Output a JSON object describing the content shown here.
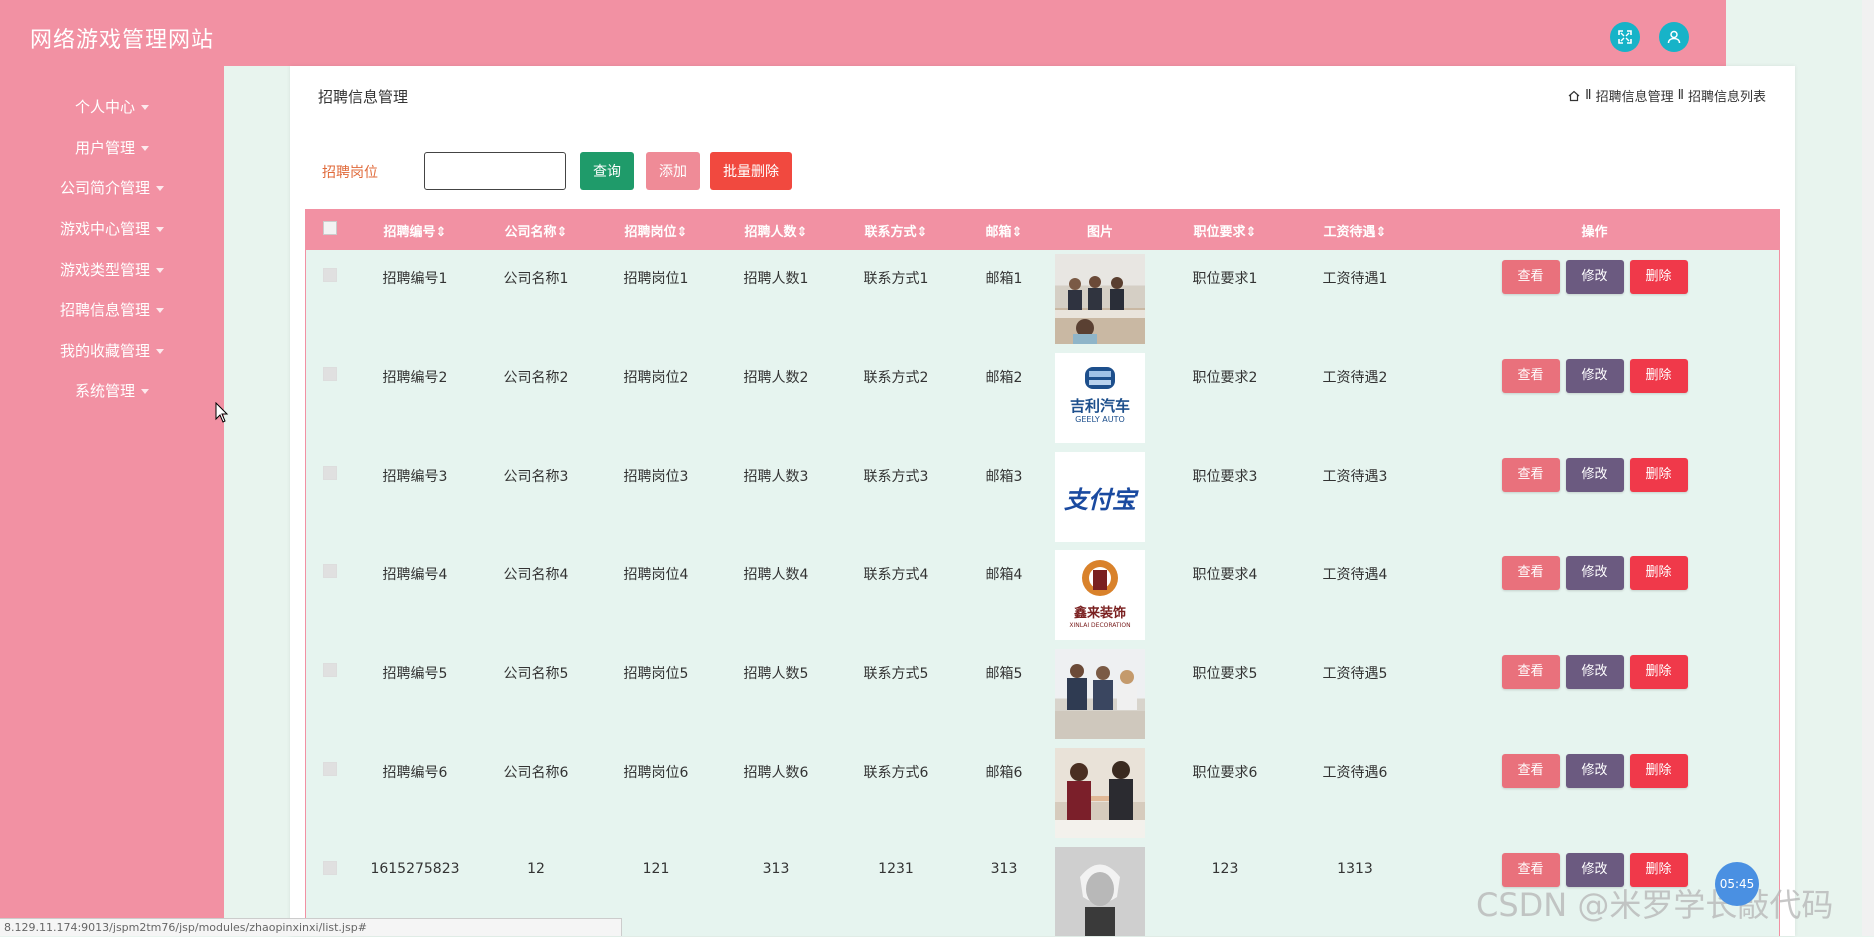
{
  "app": {
    "title": "网络游戏管理网站"
  },
  "colors": {
    "accent": "#f291a3",
    "query": "#1f9b6a",
    "add": "#ef8b97",
    "batch_delete": "#f1493f",
    "view": "#e9717c",
    "edit": "#6b5a80",
    "delete": "#f0394a"
  },
  "sidebar": {
    "items": [
      {
        "label": "个人中心"
      },
      {
        "label": "用户管理"
      },
      {
        "label": "公司简介管理"
      },
      {
        "label": "游戏中心管理"
      },
      {
        "label": "游戏类型管理"
      },
      {
        "label": "招聘信息管理"
      },
      {
        "label": "我的收藏管理"
      },
      {
        "label": "系统管理"
      }
    ]
  },
  "header": {
    "page_title": "招聘信息管理",
    "breadcrumb": [
      "招聘信息管理",
      "招聘信息列表"
    ],
    "breadcrumb_sep": "Ⅱ"
  },
  "search": {
    "label": "招聘岗位",
    "value": ""
  },
  "toolbar": {
    "query_label": "查询",
    "add_label": "添加",
    "batch_delete_label": "批量删除"
  },
  "table": {
    "columns": [
      "招聘编号",
      "公司名称",
      "招聘岗位",
      "招聘人数",
      "联系方式",
      "邮箱",
      "图片",
      "职位要求",
      "工资待遇",
      "操作"
    ],
    "sortable_mark": "⇕",
    "actions": {
      "view": "查看",
      "edit": "修改",
      "delete": "删除"
    },
    "rows": [
      {
        "id": "招聘编号1",
        "company": "公司名称1",
        "position": "招聘岗位1",
        "count": "招聘人数1",
        "contact": "联系方式1",
        "email": "邮箱1",
        "image": "meeting-photo",
        "requirement": "职位要求1",
        "salary": "工资待遇1"
      },
      {
        "id": "招聘编号2",
        "company": "公司名称2",
        "position": "招聘岗位2",
        "count": "招聘人数2",
        "contact": "联系方式2",
        "email": "邮箱2",
        "image": "geely-logo",
        "logo_text": "吉利汽车",
        "logo_sub": "GEELY AUTO",
        "requirement": "职位要求2",
        "salary": "工资待遇2"
      },
      {
        "id": "招聘编号3",
        "company": "公司名称3",
        "position": "招聘岗位3",
        "count": "招聘人数3",
        "contact": "联系方式3",
        "email": "邮箱3",
        "image": "alipay-logo",
        "logo_text": "支付宝",
        "requirement": "职位要求3",
        "salary": "工资待遇3"
      },
      {
        "id": "招聘编号4",
        "company": "公司名称4",
        "position": "招聘岗位4",
        "count": "招聘人数4",
        "contact": "联系方式4",
        "email": "邮箱4",
        "image": "decoration-logo",
        "logo_text": "鑫来装饰",
        "logo_sub": "XINLAI DECORATION",
        "requirement": "职位要求4",
        "salary": "工资待遇4"
      },
      {
        "id": "招聘编号5",
        "company": "公司名称5",
        "position": "招聘岗位5",
        "count": "招聘人数5",
        "contact": "联系方式5",
        "email": "邮箱5",
        "image": "interview-photo",
        "requirement": "职位要求5",
        "salary": "工资待遇5"
      },
      {
        "id": "招聘编号6",
        "company": "公司名称6",
        "position": "招聘岗位6",
        "count": "招聘人数6",
        "contact": "联系方式6",
        "email": "邮箱6",
        "image": "handshake-photo",
        "requirement": "职位要求6",
        "salary": "工资待遇6"
      },
      {
        "id": "1615275823",
        "company": "12",
        "position": "121",
        "count": "313",
        "contact": "1231",
        "email": "313",
        "image": "portrait-photo",
        "requirement": "123",
        "salary": "1313"
      }
    ]
  },
  "statusbar": {
    "url": "8.129.11.174:9013/jspm2tm76/jsp/modules/zhaopinxinxi/list.jsp#"
  },
  "overlay": {
    "watermark": "CSDN @米罗学长敲代码",
    "clock": "05:45"
  }
}
